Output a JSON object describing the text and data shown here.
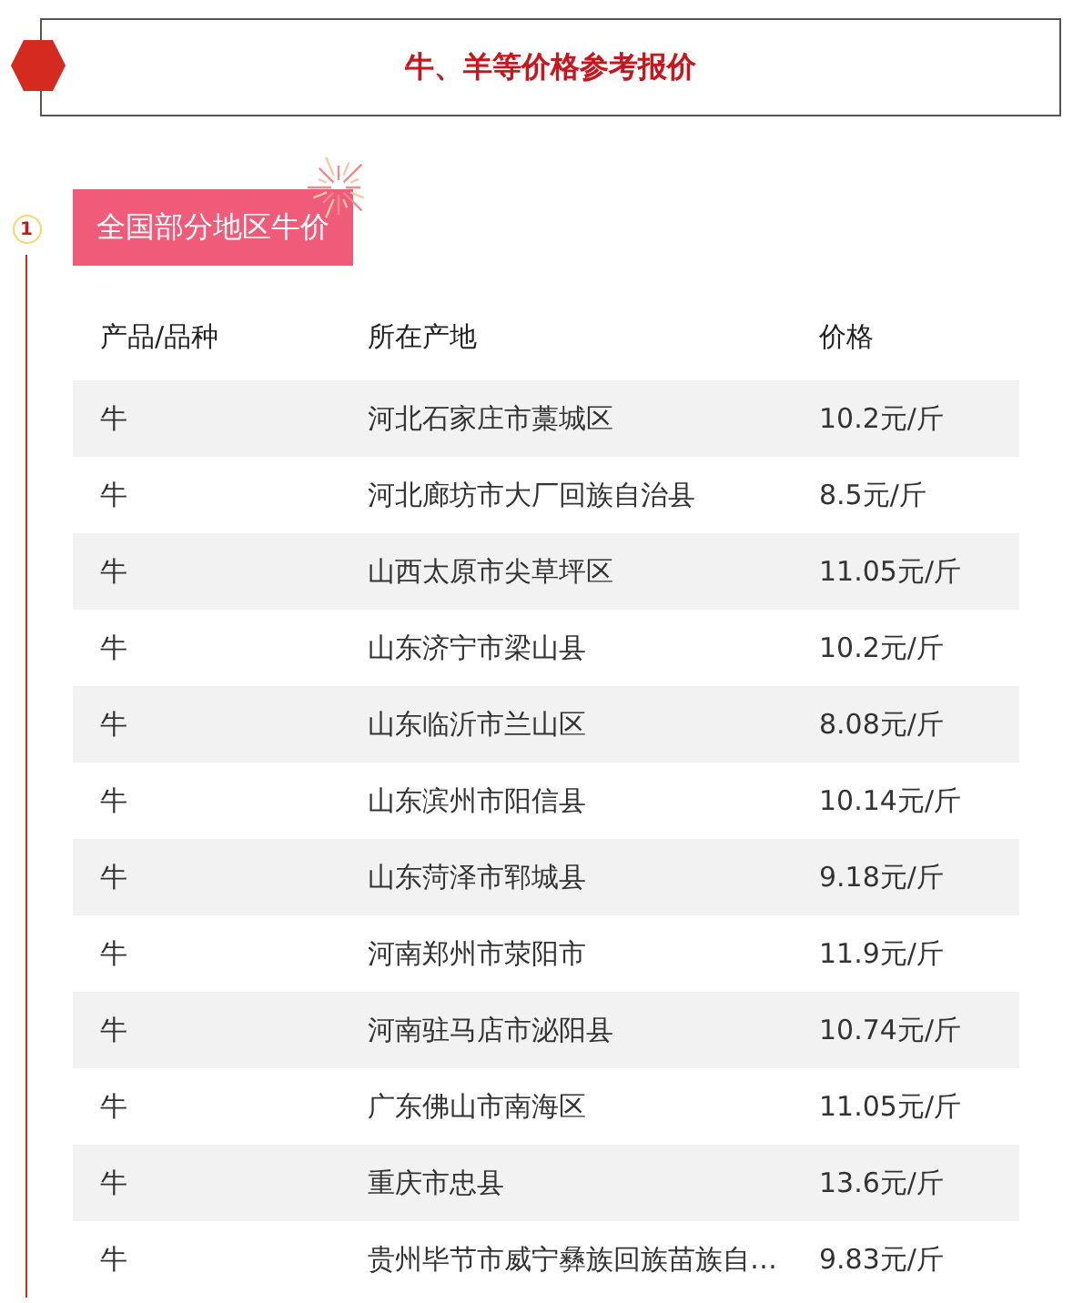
{
  "title": "牛、羊等价格参考报价",
  "section": {
    "number": "1",
    "label": "全国部分地区牛价"
  },
  "table": {
    "columns": [
      "产品/品种",
      "所在产地",
      "价格"
    ],
    "rows": [
      [
        "牛",
        "河北石家庄市藁城区",
        "10.2元/斤"
      ],
      [
        "牛",
        "河北廊坊市大厂回族自治县",
        "8.5元/斤"
      ],
      [
        "牛",
        "山西太原市尖草坪区",
        "11.05元/斤"
      ],
      [
        "牛",
        "山东济宁市梁山县",
        "10.2元/斤"
      ],
      [
        "牛",
        "山东临沂市兰山区",
        "8.08元/斤"
      ],
      [
        "牛",
        "山东滨州市阳信县",
        "10.14元/斤"
      ],
      [
        "牛",
        "山东菏泽市郓城县",
        "9.18元/斤"
      ],
      [
        "牛",
        "河南郑州市荥阳市",
        "11.9元/斤"
      ],
      [
        "牛",
        "河南驻马店市泌阳县",
        "10.74元/斤"
      ],
      [
        "牛",
        "广东佛山市南海区",
        "11.05元/斤"
      ],
      [
        "牛",
        "重庆市忠县",
        "13.6元/斤"
      ],
      [
        "牛",
        "贵州毕节市威宁彝族回族苗族自…",
        "9.83元/斤"
      ]
    ]
  }
}
